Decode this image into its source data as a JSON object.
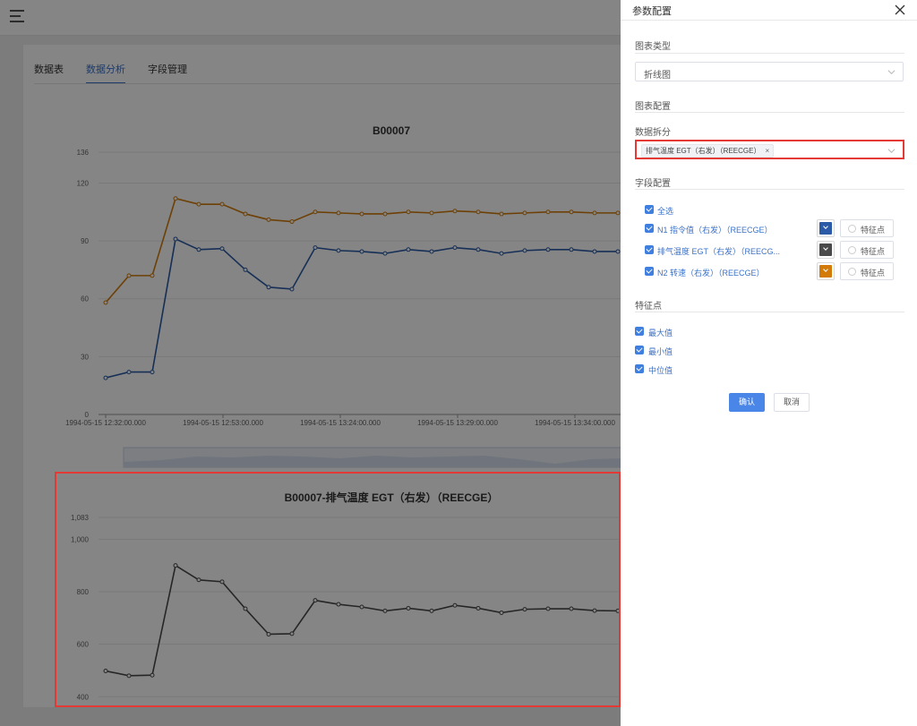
{
  "tabs": [
    {
      "label": "数据表"
    },
    {
      "label": "数据分析"
    },
    {
      "label": "字段管理"
    }
  ],
  "drawer": {
    "title": "参数配置",
    "chart_type_label": "图表类型",
    "chart_type_value": "折线图",
    "chart_config_label": "图表配置",
    "split_label": "数据拆分",
    "split_tag": "排气温度 EGT（右发）（REECGE）",
    "split_tag_close": "×",
    "fields_label": "字段配置",
    "select_all": "全选",
    "fields": [
      {
        "name": "N1 指令值（右发）（REECGE）",
        "color": "#2b5aa6",
        "feature": "特征点"
      },
      {
        "name": "排气温度 EGT（右发）（REECG...",
        "color": "#4a4a4a",
        "feature": "特征点"
      },
      {
        "name": "N2 转速（右发）（REECGE）",
        "color": "#d27b0a",
        "feature": "特征点"
      }
    ],
    "feature_label": "特征点",
    "features": [
      {
        "label": "最大值"
      },
      {
        "label": "最小值"
      },
      {
        "label": "中位值"
      }
    ],
    "confirm": "确认",
    "cancel": "取消"
  },
  "chart_data": [
    {
      "type": "line",
      "title": "B00007",
      "x": [
        "1994-05-15 12:32:00.000",
        "1994-05-15 12:53:00.000",
        "1994-05-15 13:24:00.000",
        "1994-05-15 13:29:00.000",
        "1994-05-15 13:34:00.000"
      ],
      "ylim": [
        0,
        136
      ],
      "yticks": [
        "0",
        "30",
        "60",
        "90",
        "120",
        "136"
      ],
      "grid": true,
      "series": [
        {
          "color": "#d27b0a",
          "values": [
            58,
            72,
            72,
            112,
            109,
            109,
            104,
            101,
            100,
            105,
            104.5,
            104,
            104,
            105,
            104.5,
            105.5,
            105,
            104,
            104.5,
            105,
            105,
            104.5,
            104.5
          ]
        },
        {
          "color": "#2b5aa6",
          "values": [
            19,
            22,
            22,
            91,
            85.5,
            86,
            75,
            66,
            65,
            86.5,
            85,
            84.5,
            83.5,
            85.5,
            84.5,
            86.5,
            85.5,
            83.5,
            85,
            85.5,
            85.5,
            84.5,
            84.5
          ]
        }
      ]
    },
    {
      "type": "line",
      "title": "B00007-排气温度 EGT（右发）（REECGE）",
      "ylim": [
        360,
        1083
      ],
      "yticks": [
        "400",
        "600",
        "800",
        "1,000",
        "1,083"
      ],
      "grid": true,
      "series": [
        {
          "color": "#4a4a4a",
          "values": [
            498,
            480,
            482,
            900,
            845,
            838,
            735,
            638,
            640,
            767,
            752,
            742,
            727,
            737,
            727,
            748,
            737,
            720,
            733,
            735,
            735,
            728,
            727
          ]
        }
      ]
    }
  ]
}
